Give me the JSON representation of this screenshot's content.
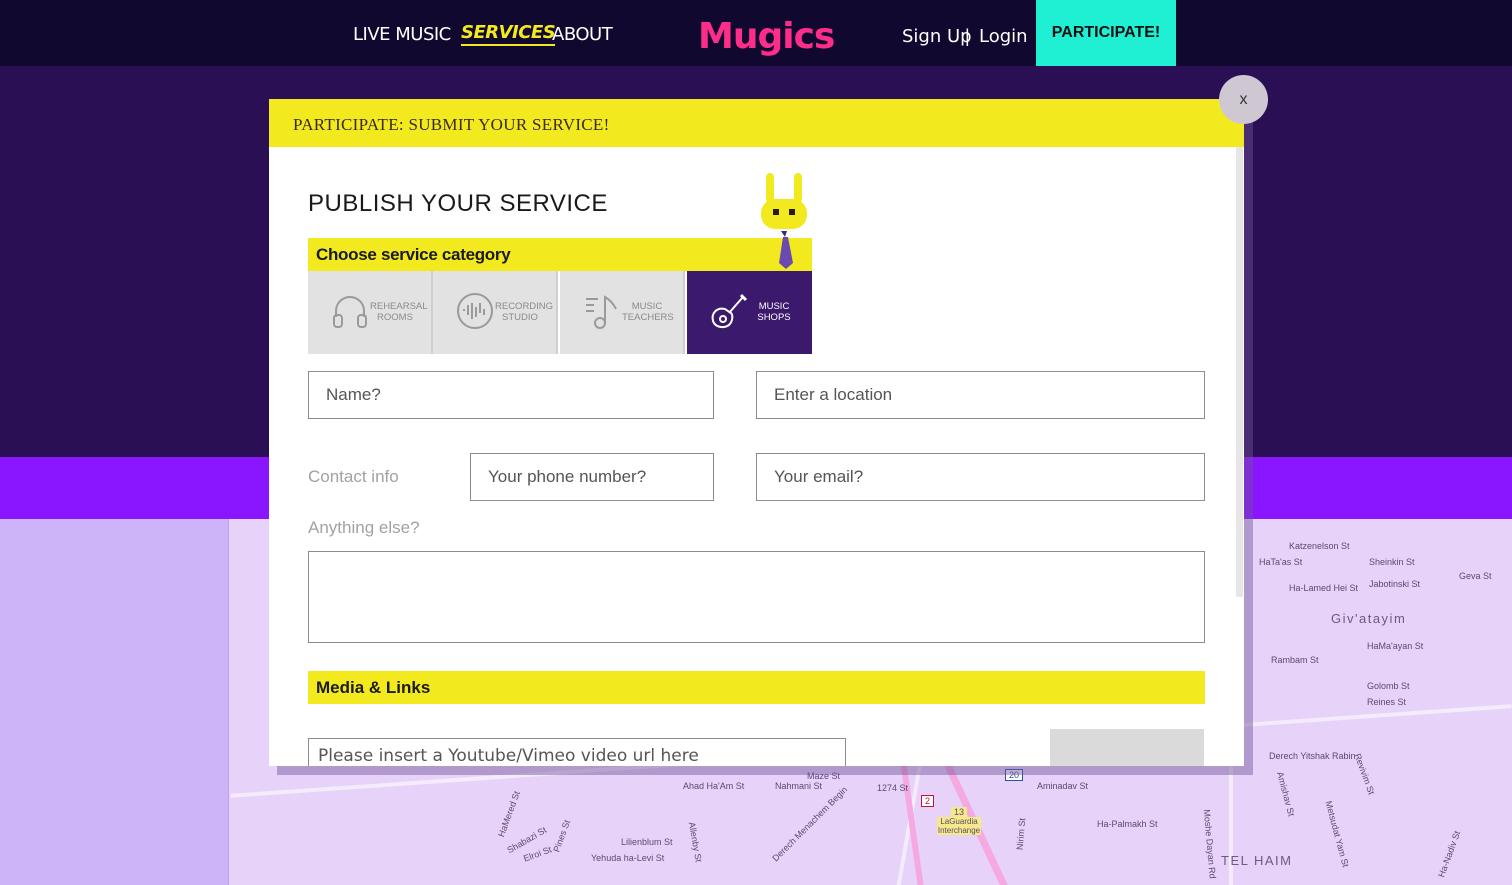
{
  "nav": {
    "links": [
      "LIVE MUSIC",
      "SERVICES",
      "ABOUT"
    ],
    "active": "SERVICES",
    "logo": "Mugics",
    "signup": "Sign Up",
    "separator": "|",
    "login": "Login",
    "participate": "PARTICIPATE!"
  },
  "modal": {
    "header": "PARTICIPATE: SUBMIT YOUR SERVICE!",
    "close": "x",
    "title": "PUBLISH YOUR SERVICE",
    "category_heading": "Choose service category",
    "categories": [
      {
        "line1": "REHEARSAL",
        "line2": "ROOMS",
        "icon": "headphones-icon"
      },
      {
        "line1": "RECORDING",
        "line2": "STUDIO",
        "icon": "soundwave-icon"
      },
      {
        "line1": "MUSIC",
        "line2": "TEACHERS",
        "icon": "music-note-icon"
      },
      {
        "line1": "MUSIC",
        "line2": "SHOPS",
        "icon": "guitar-icon"
      }
    ],
    "selected_category": "MUSIC SHOPS",
    "name_placeholder": "Name?",
    "location_placeholder": "Enter a location",
    "contact_label": "Contact info",
    "phone_placeholder": "Your phone number?",
    "email_placeholder": "Your email?",
    "anything_else_label": "Anything else?",
    "media_heading": "Media & Links",
    "video_url_placeholder": "Please insert a Youtube/Vimeo video url here"
  },
  "map": {
    "labels": [
      "Katzenelson St",
      "HaTa'as St",
      "Sheinkin St",
      "Geva St",
      "Ha-Lamed Hei St",
      "Jabotinski St",
      "Giv'atayim",
      "Rambam St",
      "HaMa'ayan St",
      "Golomb St",
      "Reines St",
      "Derech Yitshak Rabin",
      "Aminadav St",
      "Ha-Palmakh St",
      "TEL HAIM",
      "Nahmani St",
      "Maze St",
      "1274 St",
      "Ahad Ha'Am St",
      "Lilienblum St",
      "Yehuda ha-Levi St",
      "Allenby St",
      "Derech Menachem Begin",
      "HaMered St",
      "Pines St",
      "Elroi St",
      "Shabazi St",
      "LaGuardia Interchange",
      "Nirim St",
      "Moshe Dayan Rd",
      "Amishav St",
      "Metsudat Yam St",
      "Revivim St",
      "Ha-Nadiv St"
    ],
    "shields": [
      "2",
      "20",
      "13"
    ]
  },
  "colors": {
    "nav_bg": "#110830",
    "accent_yellow": "#f2ea1f",
    "accent_pink": "#ff2d8a",
    "accent_teal": "#1ff0d4",
    "purple_dark": "#2a0f55",
    "purple_bright": "#8a16ff"
  }
}
